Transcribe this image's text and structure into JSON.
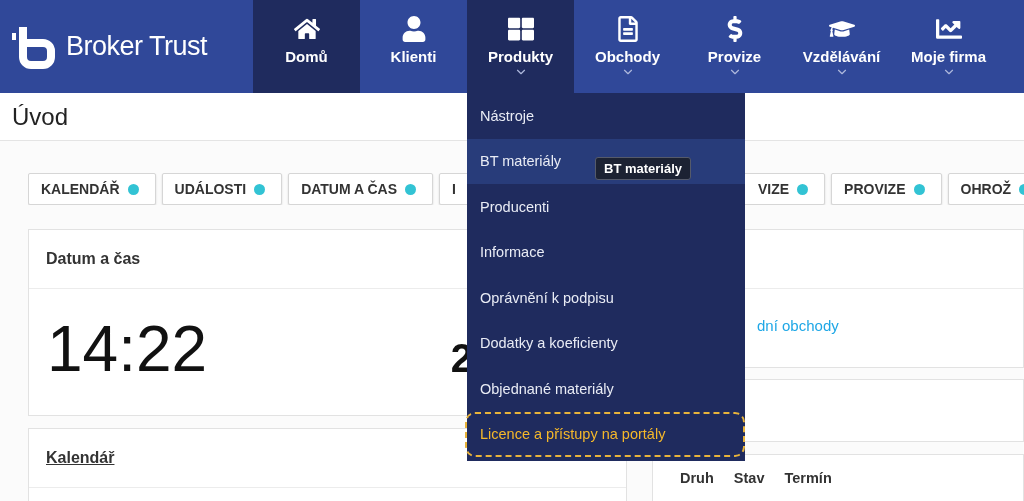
{
  "logo": {
    "text": "Broker Trust"
  },
  "nav": [
    {
      "label": "Domů",
      "selected": true,
      "expanded": false,
      "dropdown": false
    },
    {
      "label": "Klienti",
      "selected": false,
      "expanded": false,
      "dropdown": false
    },
    {
      "label": "Produkty",
      "selected": true,
      "expanded": true,
      "dropdown": true
    },
    {
      "label": "Obchody",
      "selected": false,
      "expanded": false,
      "dropdown": true
    },
    {
      "label": "Provize",
      "selected": false,
      "expanded": false,
      "dropdown": true
    },
    {
      "label": "Vzdělávání",
      "selected": false,
      "expanded": false,
      "dropdown": true
    },
    {
      "label": "Moje firma",
      "selected": false,
      "expanded": false,
      "dropdown": true
    }
  ],
  "dropdown_menu": {
    "items": [
      {
        "label": "Nástroje",
        "hovered": false,
        "marked": false
      },
      {
        "label": "BT materiály",
        "hovered": true,
        "marked": false
      },
      {
        "label": "Producenti",
        "hovered": false,
        "marked": false
      },
      {
        "label": "Informace",
        "hovered": false,
        "marked": false
      },
      {
        "label": "Oprávnění k podpisu",
        "hovered": false,
        "marked": false
      },
      {
        "label": "Dodatky a koeficienty",
        "hovered": false,
        "marked": false
      },
      {
        "label": "Objednané materiály",
        "hovered": false,
        "marked": false
      },
      {
        "label": "Licence a přístupy na portály",
        "hovered": false,
        "marked": true
      }
    ],
    "tooltip": "BT materiály"
  },
  "page_title": "Úvod",
  "chips": [
    {
      "label": "KALENDÁŘ"
    },
    {
      "label": "UDÁLOSTI"
    },
    {
      "label": "DATUM A ČAS"
    },
    {
      "label": "I"
    },
    {
      "label": "VIZE"
    },
    {
      "label": "PROVIZE"
    },
    {
      "label": "OHROŽ"
    }
  ],
  "date_time_card": {
    "title": "Datum a čas",
    "time": "14:22",
    "date": "2"
  },
  "right_card": {
    "link": "dní obchody"
  },
  "calendar_card": {
    "title": "Kalendář"
  },
  "table_card": {
    "columns": [
      "Druh",
      "Stav",
      "Termín"
    ]
  }
}
